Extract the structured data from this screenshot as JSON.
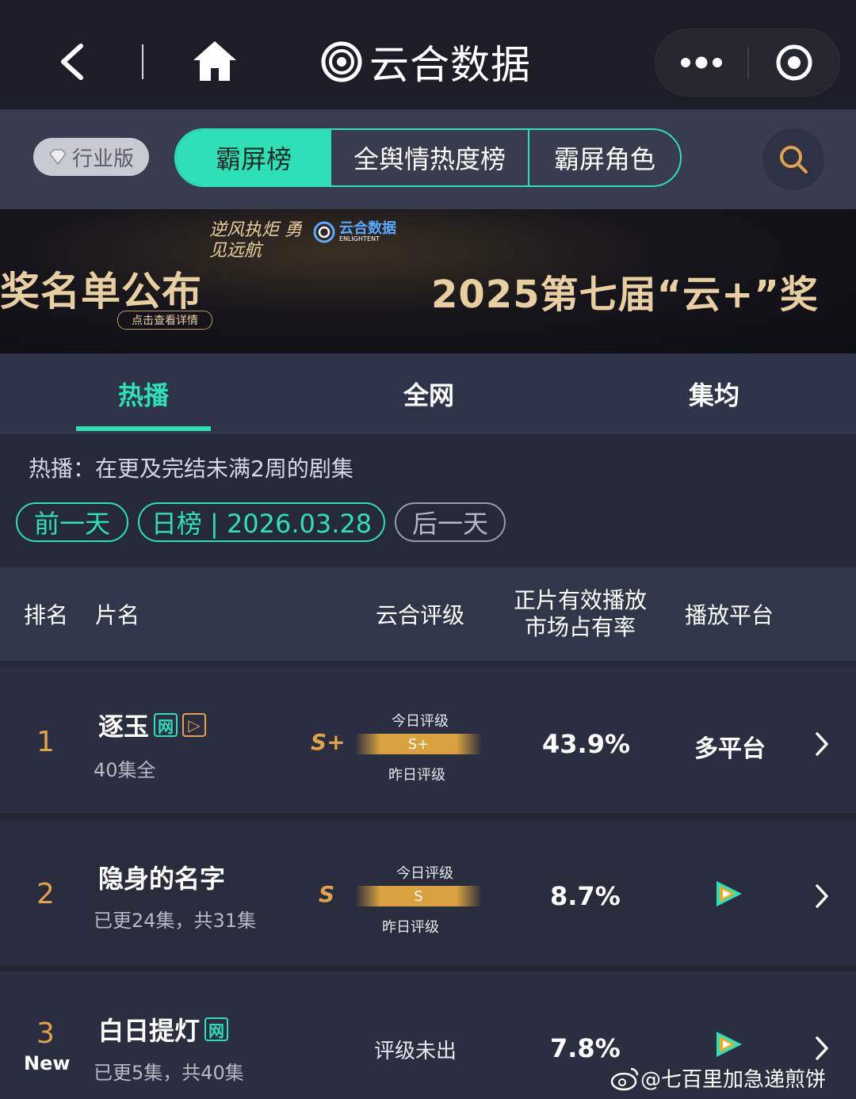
{
  "app": {
    "title": "云合数据"
  },
  "nav": {
    "industry_label": "行业版",
    "segments": [
      "霸屏榜",
      "全舆情热度榜",
      "霸屏角色"
    ]
  },
  "banner": {
    "left_text": "奖名单公布",
    "detail_label": "点击查看详情",
    "slogan": "逆风执炬 勇见远航",
    "logo_text": "云合数据",
    "logo_sub": "ENLIGHTENT",
    "right_text": "2025第七届“云+”奖"
  },
  "tabs": [
    "热播",
    "全网",
    "集均"
  ],
  "description": "热播：在更及完结未满2周的剧集",
  "date_nav": {
    "prev": "前一天",
    "current": "日榜 | 2026.03.28",
    "next": "后一天"
  },
  "table": {
    "headers": {
      "rank": "排名",
      "name": "片名",
      "rating": "云合评级",
      "share_line1": "正片有效播放",
      "share_line2": "市场占有率",
      "platform": "播放平台"
    },
    "rows": [
      {
        "rank": "1",
        "title": "逐玉",
        "badges": [
          "网",
          "▷"
        ],
        "episodes": "40集全",
        "grade": "S+",
        "today_label": "今日评级",
        "bar_grade": "S+",
        "yesterday_label": "昨日评级",
        "share": "43.9%",
        "platform": "多平台"
      },
      {
        "rank": "2",
        "title": "隐身的名字",
        "badges": [],
        "episodes": "已更24集，共31集",
        "grade": "S",
        "today_label": "今日评级",
        "bar_grade": "S",
        "yesterday_label": "昨日评级",
        "share": "8.7%",
        "platform_icon": "tencent-video-icon"
      },
      {
        "rank": "3",
        "new_label": "New",
        "title": "白日提灯",
        "badges": [
          "网"
        ],
        "episodes": "已更5集，共40集",
        "grade_text": "评级未出",
        "share": "7.8%",
        "platform_icon": "tencent-video-icon"
      }
    ]
  },
  "watermark": "@七百里加急递煎饼",
  "colors": {
    "accent": "#2de0b5",
    "gold": "#e0a24a",
    "bg": "#262938"
  }
}
